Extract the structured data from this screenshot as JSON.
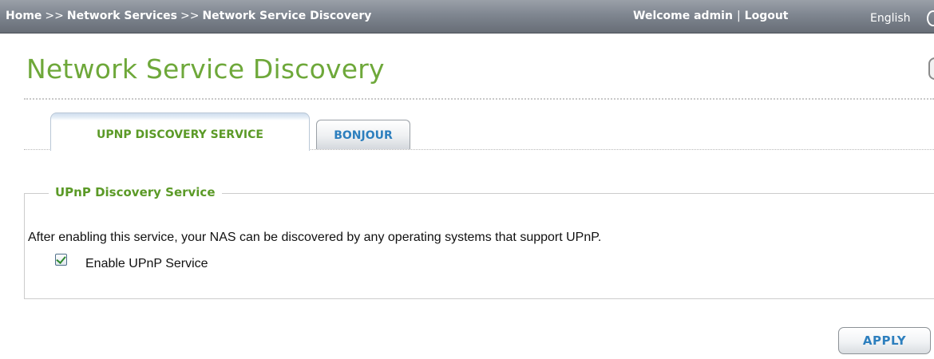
{
  "breadcrumb": {
    "items": [
      "Home",
      "Network Services",
      "Network Service Discovery"
    ],
    "separator": ">>"
  },
  "user": {
    "welcome": "Welcome admin",
    "logout": "Logout",
    "divider": "|"
  },
  "language": {
    "selected": "English"
  },
  "page": {
    "title": "Network Service Discovery"
  },
  "tabs": [
    {
      "label": "UPNP DISCOVERY SERVICE",
      "active": true
    },
    {
      "label": "BONJOUR",
      "active": false
    }
  ],
  "section": {
    "legend": "UPnP Discovery Service",
    "description": "After enabling this service, your NAS can be discovered by any operating systems that support UPnP.",
    "checkbox": {
      "label": "Enable UPnP Service",
      "checked": true
    }
  },
  "actions": {
    "apply_label": "APPLY"
  },
  "colors": {
    "title_green": "#6ea83a",
    "tab_blue": "#2d7fbe",
    "topbar": "#7f8690"
  },
  "icons": {
    "language": "globe-icon",
    "help": "help-icon",
    "checkbox": "checkmark-icon"
  }
}
